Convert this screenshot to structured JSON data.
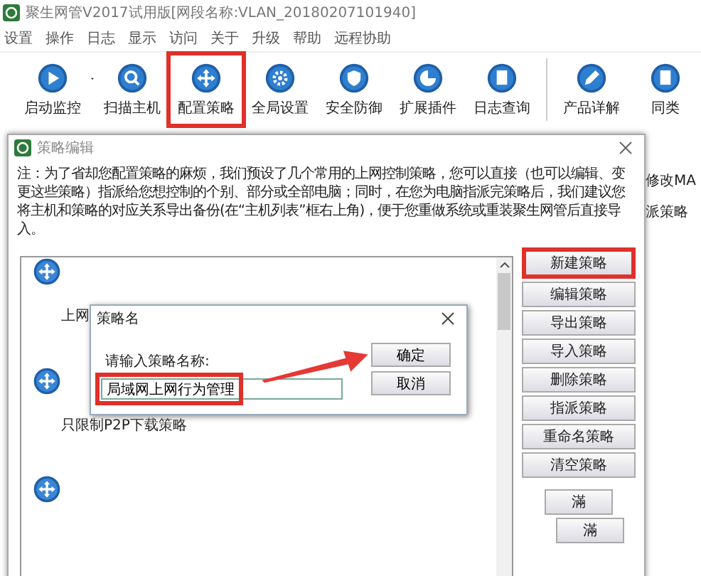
{
  "window": {
    "title": "聚生网管V2017试用版[网段名称:VLAN_20180207101940]"
  },
  "menu": [
    "设置",
    "操作",
    "日志",
    "显示",
    "访问",
    "关于",
    "升级",
    "帮助",
    "远程协助"
  ],
  "toolbar": [
    {
      "label": "启动监控",
      "dropdown": true,
      "highlighted": false
    },
    {
      "label": "扫描主机",
      "highlighted": false
    },
    {
      "label": "配置策略",
      "highlighted": true
    },
    {
      "label": "全局设置",
      "highlighted": false
    },
    {
      "label": "安全防御",
      "highlighted": false
    },
    {
      "label": "扩展插件",
      "highlighted": false
    },
    {
      "label": "日志查询",
      "highlighted": false
    },
    {
      "label": "产品详解",
      "highlighted": false,
      "separator": true
    },
    {
      "label": "同类",
      "highlighted": false
    }
  ],
  "background_texts": [
    "修改MA",
    "派策略"
  ],
  "dialog": {
    "title": "策略编辑",
    "note": "注：为了省却您配置策略的麻烦，我们预设了几个常用的上网控制策略，您可以直接（也可以编辑、变更这些策略）指派给您想控制的个别、部分或全部电脑；同时，在您为电脑指派完策略后，我们建议您将主机和策略的对应关系导出备份(在“主机列表”框右上角)，便于您重做系统或重装聚生网管后直接导入。",
    "policies": [
      {
        "kind": "policy",
        "label": "上网"
      },
      {
        "kind": "policy",
        "label": "只限制P2P下载策略"
      },
      {
        "kind": "policy"
      }
    ],
    "buttons": [
      {
        "label": "新建策略",
        "kind": "main",
        "highlighted": true
      },
      {
        "label": "编辑策略",
        "kind": "main",
        "highlighted": false
      },
      {
        "label": "导出策略",
        "kind": "main",
        "highlighted": false
      },
      {
        "label": "导入策略",
        "kind": "main",
        "highlighted": false
      },
      {
        "label": "删除策略",
        "kind": "main",
        "highlighted": false
      },
      {
        "label": "指派策略",
        "kind": "main",
        "highlighted": false
      },
      {
        "label": "重命名策略",
        "kind": "main",
        "highlighted": false
      },
      {
        "label": "清空策略",
        "kind": "main",
        "highlighted": false
      },
      {
        "label": "滿",
        "kind": "small",
        "highlighted": false
      },
      {
        "label": "滿",
        "kind": "small2",
        "highlighted": false
      }
    ]
  },
  "name_dialog": {
    "title": "策略名",
    "prompt": "请输入策略名称:",
    "value": "局域网上网行为管理",
    "value_highlighted": true,
    "buttons": [
      "确定",
      "取消"
    ],
    "arrow": true
  }
}
